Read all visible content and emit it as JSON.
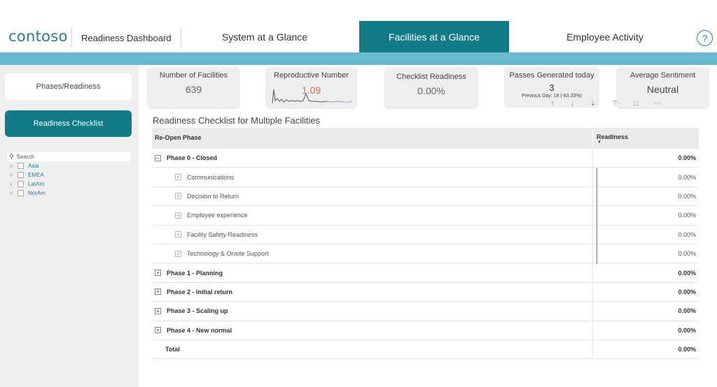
{
  "header": {
    "logo": "contoso",
    "app_title": "Readiness Dashboard",
    "tabs": [
      "System at a Glance",
      "Facilities at a Glance",
      "Employee Activity"
    ],
    "active_tab": "Facilities at a Glance",
    "help_icon": "?"
  },
  "colors": {
    "accent": "#127b86",
    "band": "#6ab9cf",
    "sidebar_bg": "#efefef",
    "repro_value": "#e06b4f"
  },
  "sidebar": {
    "buttons": [
      "Phases/Readiness",
      "Readiness Checklist"
    ],
    "active_button": "Readiness Checklist",
    "search_placeholder": "Search",
    "regions": [
      "Asia",
      "EMEA",
      "LatAm",
      "NorAm"
    ]
  },
  "kpis": {
    "facilities": {
      "label": "Number of Facilities",
      "value": "639"
    },
    "reproductive": {
      "label": "Reproductive Number",
      "value": "1.09"
    },
    "checklist": {
      "label": "Checklist Readiness",
      "value": "0.00%"
    },
    "passes": {
      "label": "Passes Generated today",
      "value": "3",
      "sub": "Previous Day: 18 (-83.33%)"
    },
    "sentiment": {
      "label": "Average Sentiment",
      "value": "Neutral"
    }
  },
  "matrix": {
    "title": "Readiness Checklist for Multiple Facilities",
    "col1": "Re-Open Phase",
    "col2": "Readiness",
    "rows": [
      {
        "label": "Phase 0 - Closed",
        "value": "0.00%",
        "kind": "phase",
        "expander": "−"
      },
      {
        "label": "Communications",
        "value": "0.00%",
        "kind": "sub",
        "expander": "+"
      },
      {
        "label": "Decision to Return",
        "value": "0.00%",
        "kind": "sub",
        "expander": "+"
      },
      {
        "label": "Employee experience",
        "value": "0.00%",
        "kind": "sub",
        "expander": "+"
      },
      {
        "label": "Facility Safety Readiness",
        "value": "0.00%",
        "kind": "sub",
        "expander": "+"
      },
      {
        "label": "Technology & Onsite Support",
        "value": "0.00%",
        "kind": "sub",
        "expander": "+"
      },
      {
        "label": "Phase 1 - Planning",
        "value": "0.00%",
        "kind": "phase",
        "expander": "+"
      },
      {
        "label": "Phase 2 - Initial return",
        "value": "0.00%",
        "kind": "phase",
        "expander": "+"
      },
      {
        "label": "Phase 3 - Scaling up",
        "value": "0.00%",
        "kind": "phase",
        "expander": "+"
      },
      {
        "label": "Phase 4 - New normal",
        "value": "0.00%",
        "kind": "phase",
        "expander": "+"
      },
      {
        "label": "Total",
        "value": "0.00%",
        "kind": "total",
        "expander": ""
      }
    ]
  }
}
